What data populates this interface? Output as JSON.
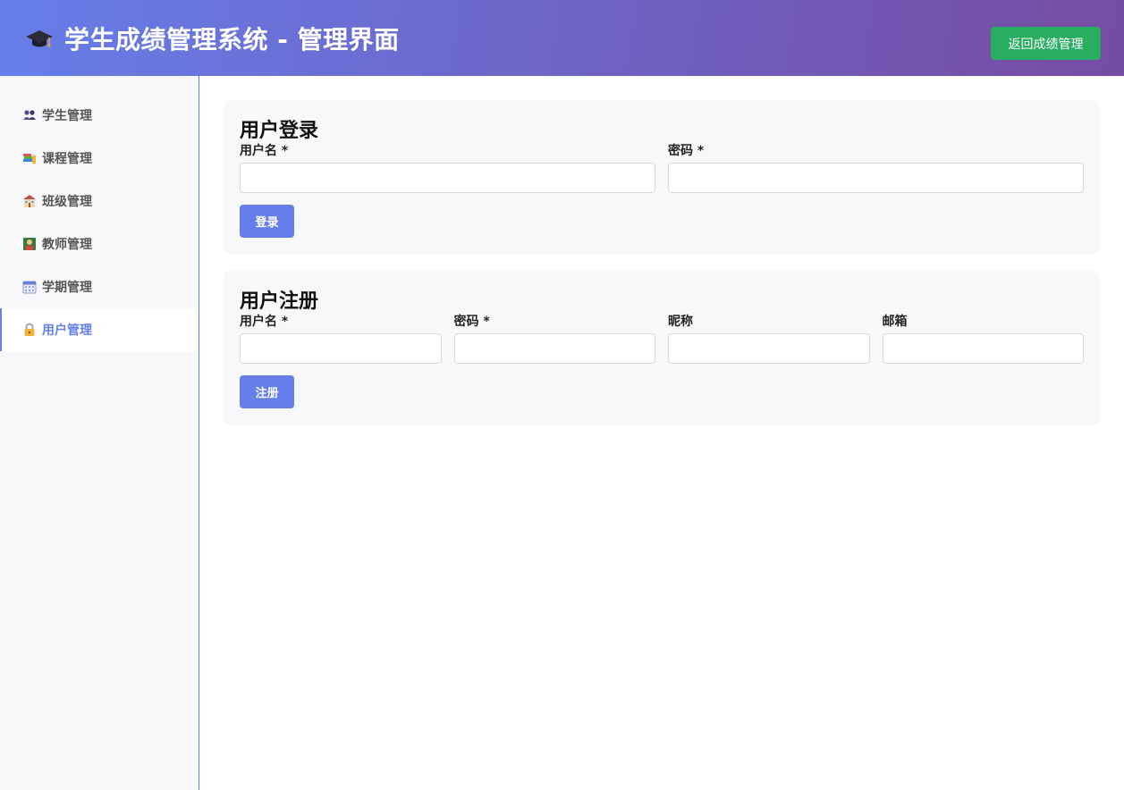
{
  "header": {
    "title": "学生成绩管理系统 - 管理界面",
    "logo_icon": "graduation-cap-icon",
    "back_label": "返回成绩管理",
    "back_color": "#27ae60",
    "gradient": [
      "#667eea",
      "#764ba2"
    ]
  },
  "sidebar": {
    "items": [
      {
        "label": "学生管理",
        "icon": "students-icon",
        "active": false
      },
      {
        "label": "课程管理",
        "icon": "books-icon",
        "active": false
      },
      {
        "label": "班级管理",
        "icon": "school-icon",
        "active": false
      },
      {
        "label": "教师管理",
        "icon": "teacher-icon",
        "active": false
      },
      {
        "label": "学期管理",
        "icon": "calendar-icon",
        "active": false
      },
      {
        "label": "用户管理",
        "icon": "lock-icon",
        "active": true
      }
    ],
    "accent": "#667eea"
  },
  "login": {
    "title": "用户登录",
    "username_label": "用户名 *",
    "username_value": "",
    "password_label": "密码 *",
    "password_value": "",
    "submit_label": "登录"
  },
  "register": {
    "title": "用户注册",
    "username_label": "用户名 *",
    "username_value": "",
    "password_label": "密码 *",
    "password_value": "",
    "nickname_label": "昵称",
    "nickname_value": "",
    "email_label": "邮箱",
    "email_value": "",
    "submit_label": "注册"
  }
}
